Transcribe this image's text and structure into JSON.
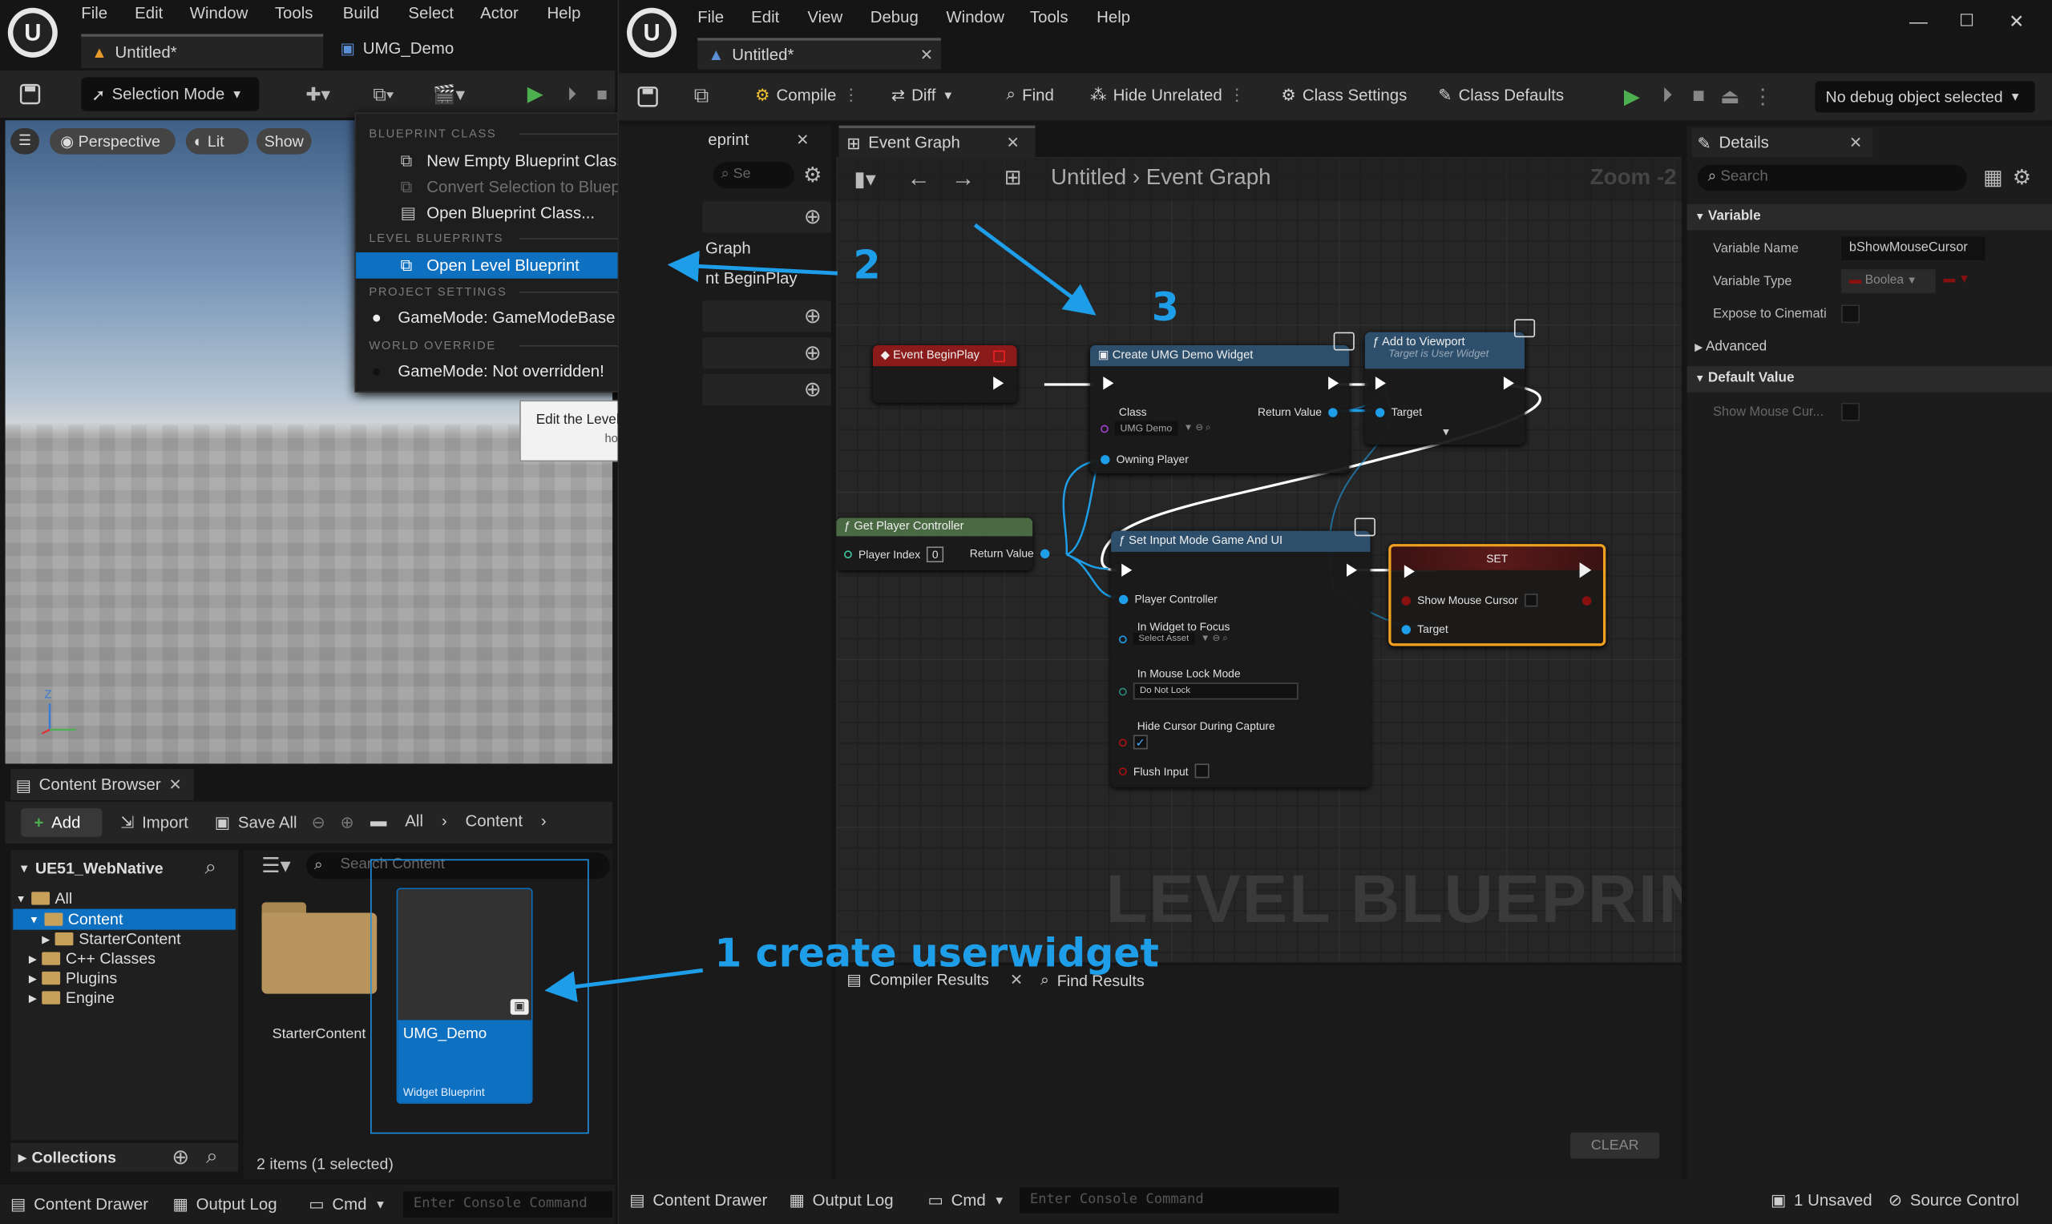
{
  "left_window": {
    "menu": [
      "File",
      "Edit",
      "Window",
      "Tools",
      "Build",
      "Select",
      "Actor",
      "Help"
    ],
    "tabs": [
      {
        "label": "Untitled*"
      },
      {
        "label": "UMG_Demo"
      }
    ],
    "toolbar": {
      "selection_mode": "Selection Mode"
    },
    "viewport": {
      "perspective": "Perspective",
      "lit": "Lit",
      "show": "Show",
      "axis_z": "Z"
    },
    "content_browser": {
      "tab": "Content Browser",
      "add": "Add",
      "import": "Import",
      "save_all": "Save All",
      "breadcrumb": [
        "All",
        "Content"
      ],
      "project": "UE51_WebNative",
      "search_placeholder": "Search Content",
      "tree": [
        "All",
        "Content",
        "StarterContent",
        "C++ Classes",
        "Plugins",
        "Engine"
      ],
      "assets": [
        {
          "name": "StarterContent"
        },
        {
          "name": "UMG_Demo",
          "type": "Widget Blueprint"
        }
      ],
      "collections": "Collections",
      "status": "2 items (1 selected)"
    },
    "bottom_bar": {
      "content_drawer": "Content Drawer",
      "output_log": "Output Log",
      "cmd": "Cmd",
      "console_placeholder": "Enter Console Command"
    }
  },
  "dropdown": {
    "sections": [
      "BLUEPRINT CLASS",
      "LEVEL BLUEPRINTS",
      "PROJECT SETTINGS",
      "WORLD OVERRIDE"
    ],
    "items": {
      "new_empty": "New Empty Blueprint Class...",
      "convert": "Convert Selection to Blueprint Class...",
      "open_class": "Open Blueprint Class...",
      "open_level": "Open Level Blueprint",
      "gamemode_base": "GameMode: GameModeBase",
      "gamemode_override": "GameMode: Not overridden!"
    },
    "tooltip": {
      "line1": "Edit the Level Blueprint for the current level",
      "line2": "hold (Ctrl + Alt) for more"
    }
  },
  "right_window": {
    "menu": [
      "File",
      "Edit",
      "View",
      "Debug",
      "Window",
      "Tools",
      "Help"
    ],
    "tab": "Untitled*",
    "toolbar": {
      "compile": "Compile",
      "diff": "Diff",
      "find": "Find",
      "hide_unrelated": "Hide Unrelated",
      "class_settings": "Class Settings",
      "class_defaults": "Class Defaults",
      "debug": "No debug object selected"
    },
    "my_blueprint": {
      "tab": "eprint",
      "search": "Se",
      "graph": "Graph",
      "begin_play": "nt BeginPlay"
    },
    "graph": {
      "tab": "Event Graph",
      "breadcrumb_root": "Untitled",
      "breadcrumb_leaf": "Event Graph",
      "zoom": "Zoom -2",
      "watermark": "LEVEL BLUEPRINT"
    },
    "nodes": {
      "begin_play": "Event BeginPlay",
      "create_widget": {
        "title": "Create UMG Demo Widget",
        "class": "Class",
        "class_value": "UMG Demo",
        "return": "Return Value",
        "owning": "Owning Player"
      },
      "add_viewport": {
        "title": "Add to Viewport",
        "subtitle": "Target is User Widget",
        "target": "Target"
      },
      "get_pc": {
        "title": "Get Player Controller",
        "index": "Player Index",
        "index_value": "0",
        "return": "Return Value"
      },
      "set_input": {
        "title": "Set Input Mode Game And UI",
        "pc": "Player Controller",
        "focus": "In Widget to Focus",
        "focus_value": "Select Asset",
        "lock": "In Mouse Lock Mode",
        "lock_value": "Do Not Lock",
        "hide": "Hide Cursor During Capture",
        "flush": "Flush Input"
      },
      "set": {
        "title": "SET",
        "show": "Show Mouse Cursor",
        "target": "Target"
      }
    },
    "bottom_tabs": {
      "compiler": "Compiler Results",
      "find": "Find Results",
      "clear": "CLEAR"
    },
    "details": {
      "tab": "Details",
      "search": "Search",
      "variable_section": "Variable",
      "var_name_label": "Variable Name",
      "var_name_value": "bShowMouseCursor",
      "var_type_label": "Variable Type",
      "var_type_value": "Boolea",
      "expose_label": "Expose to Cinemati",
      "advanced": "Advanced",
      "default_section": "Default Value",
      "show_mouse_label": "Show Mouse Cur..."
    },
    "bottom_bar": {
      "content_drawer": "Content Drawer",
      "output_log": "Output Log",
      "cmd": "Cmd",
      "console_placeholder": "Enter Console Command",
      "unsaved": "1 Unsaved",
      "source_control": "Source Control"
    }
  },
  "annotations": {
    "one": "1 create userwidget",
    "two": "2",
    "three": "3"
  },
  "colors": {
    "accent": "#1e9ee8",
    "selection": "#0e70c0",
    "set_highlight": "#f0a020",
    "event_red": "#8b1a1a",
    "func_blue": "#2e4f6b",
    "pure_green": "#4a6a44"
  }
}
